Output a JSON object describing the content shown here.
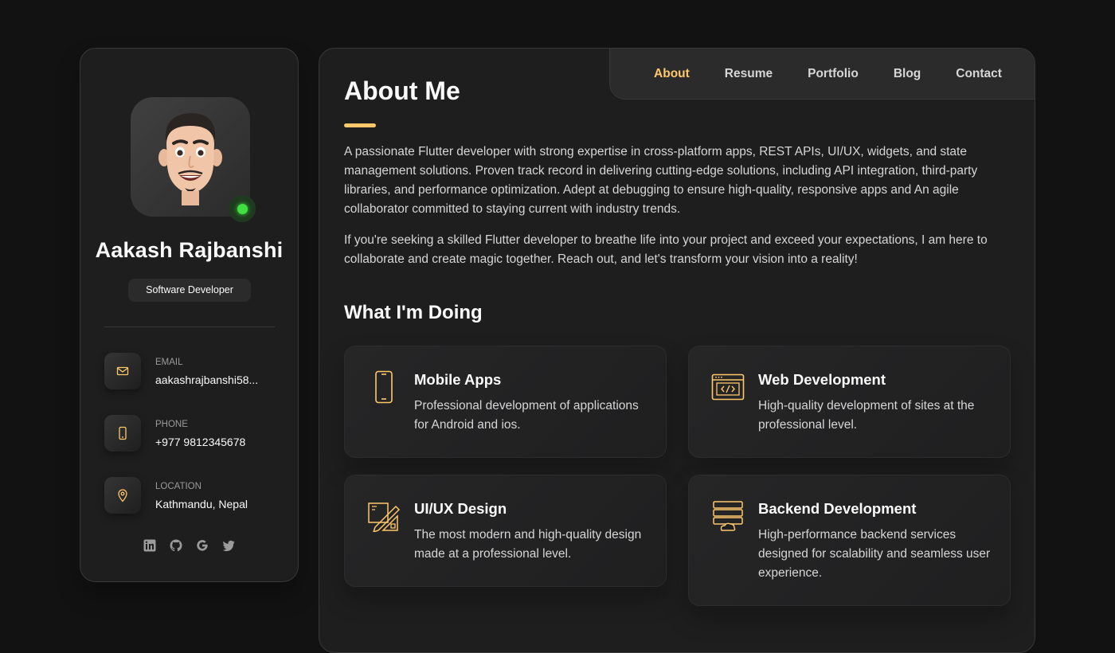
{
  "colors": {
    "accent": "#ffc86b",
    "online": "#3fe03f"
  },
  "profile": {
    "name": "Aakash Rajbanshi",
    "title": "Software Developer",
    "avatar": "memoji-avatar",
    "status": "online"
  },
  "contacts": [
    {
      "label": "Email",
      "value": "aakashrajbanshi58...",
      "icon": "mail-icon"
    },
    {
      "label": "Phone",
      "value": "+977 9812345678",
      "icon": "phone-icon"
    },
    {
      "label": "Location",
      "value": "Kathmandu, Nepal",
      "icon": "location-pin-icon"
    }
  ],
  "socials": [
    "linkedin-icon",
    "github-icon",
    "google-icon",
    "twitter-icon"
  ],
  "nav": {
    "items": [
      "About",
      "Resume",
      "Portfolio",
      "Blog",
      "Contact"
    ],
    "active": "About"
  },
  "about": {
    "title": "About Me",
    "paragraphs": [
      "A passionate Flutter developer with strong expertise in cross-platform apps, REST APIs, UI/UX, widgets, and state management solutions. Proven track record in delivering cutting-edge solutions, including API integration, third-party libraries, and performance optimization. Adept at debugging to ensure high-quality, responsive apps and An agile collaborator committed to staying current with industry trends.",
      "If you're seeking a skilled Flutter developer to breathe life into your project and exceed your expectations, I am here to collaborate and create magic together. Reach out, and let's transform your vision into a reality!"
    ]
  },
  "services": {
    "title": "What I'm Doing",
    "items": [
      {
        "title": "Mobile Apps",
        "text": "Professional development of applications for Android and ios.",
        "icon": "mobile-icon"
      },
      {
        "title": "Web Development",
        "text": "High-quality development of sites at the professional level.",
        "icon": "code-window-icon"
      },
      {
        "title": "UI/UX Design",
        "text": "The most modern and high-quality design made at a professional level.",
        "icon": "design-tools-icon"
      },
      {
        "title": "Backend Development",
        "text": "High-performance backend services designed for scalability and seamless user experience.",
        "icon": "server-icon"
      }
    ]
  }
}
